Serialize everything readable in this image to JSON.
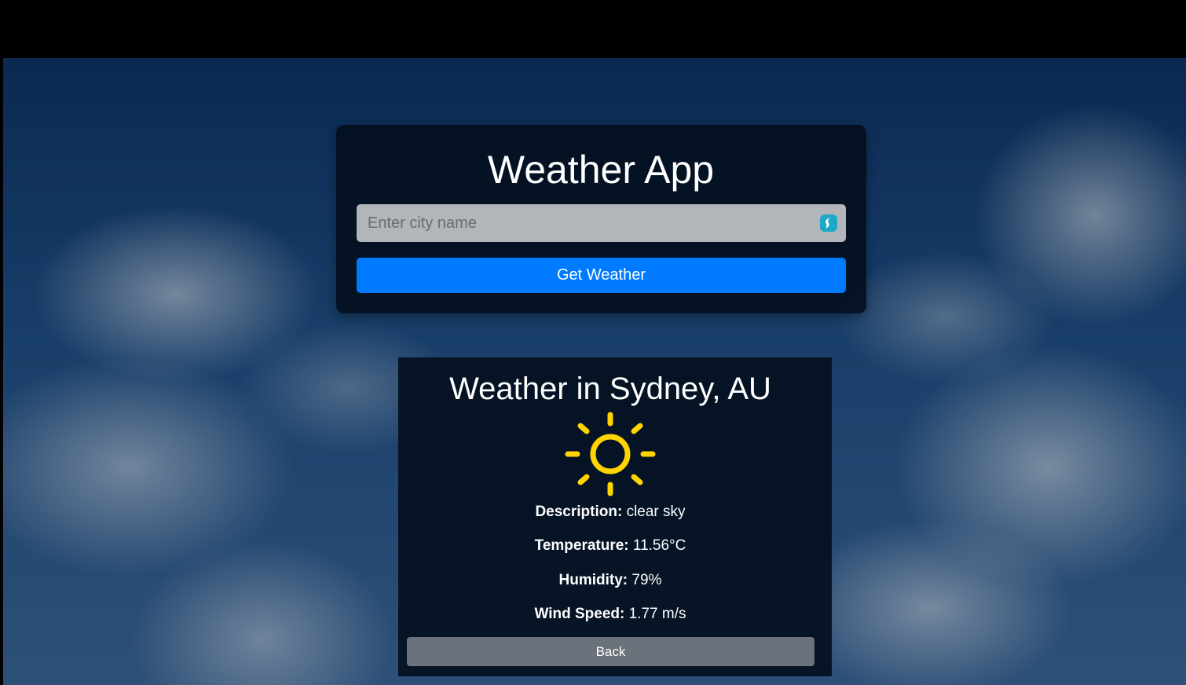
{
  "app": {
    "title": "Weather App"
  },
  "search": {
    "placeholder": "Enter city name",
    "value": "",
    "button_label": "Get Weather",
    "extension_icon": "surfshark-icon"
  },
  "result": {
    "title": "Weather in Sydney, AU",
    "icon": "sun-icon",
    "description_label": "Description:",
    "description_value": " clear sky",
    "temperature_label": "Temperature:",
    "temperature_value": " 11.56°C",
    "humidity_label": "Humidity:",
    "humidity_value": " 79%",
    "wind_label": "Wind Speed:",
    "wind_value": " 1.77 m/s",
    "back_label": "Back"
  },
  "colors": {
    "primary_button": "#007bff",
    "secondary_button": "#6c727b",
    "sun": "#ffd400",
    "card_background": "#030f1e"
  }
}
